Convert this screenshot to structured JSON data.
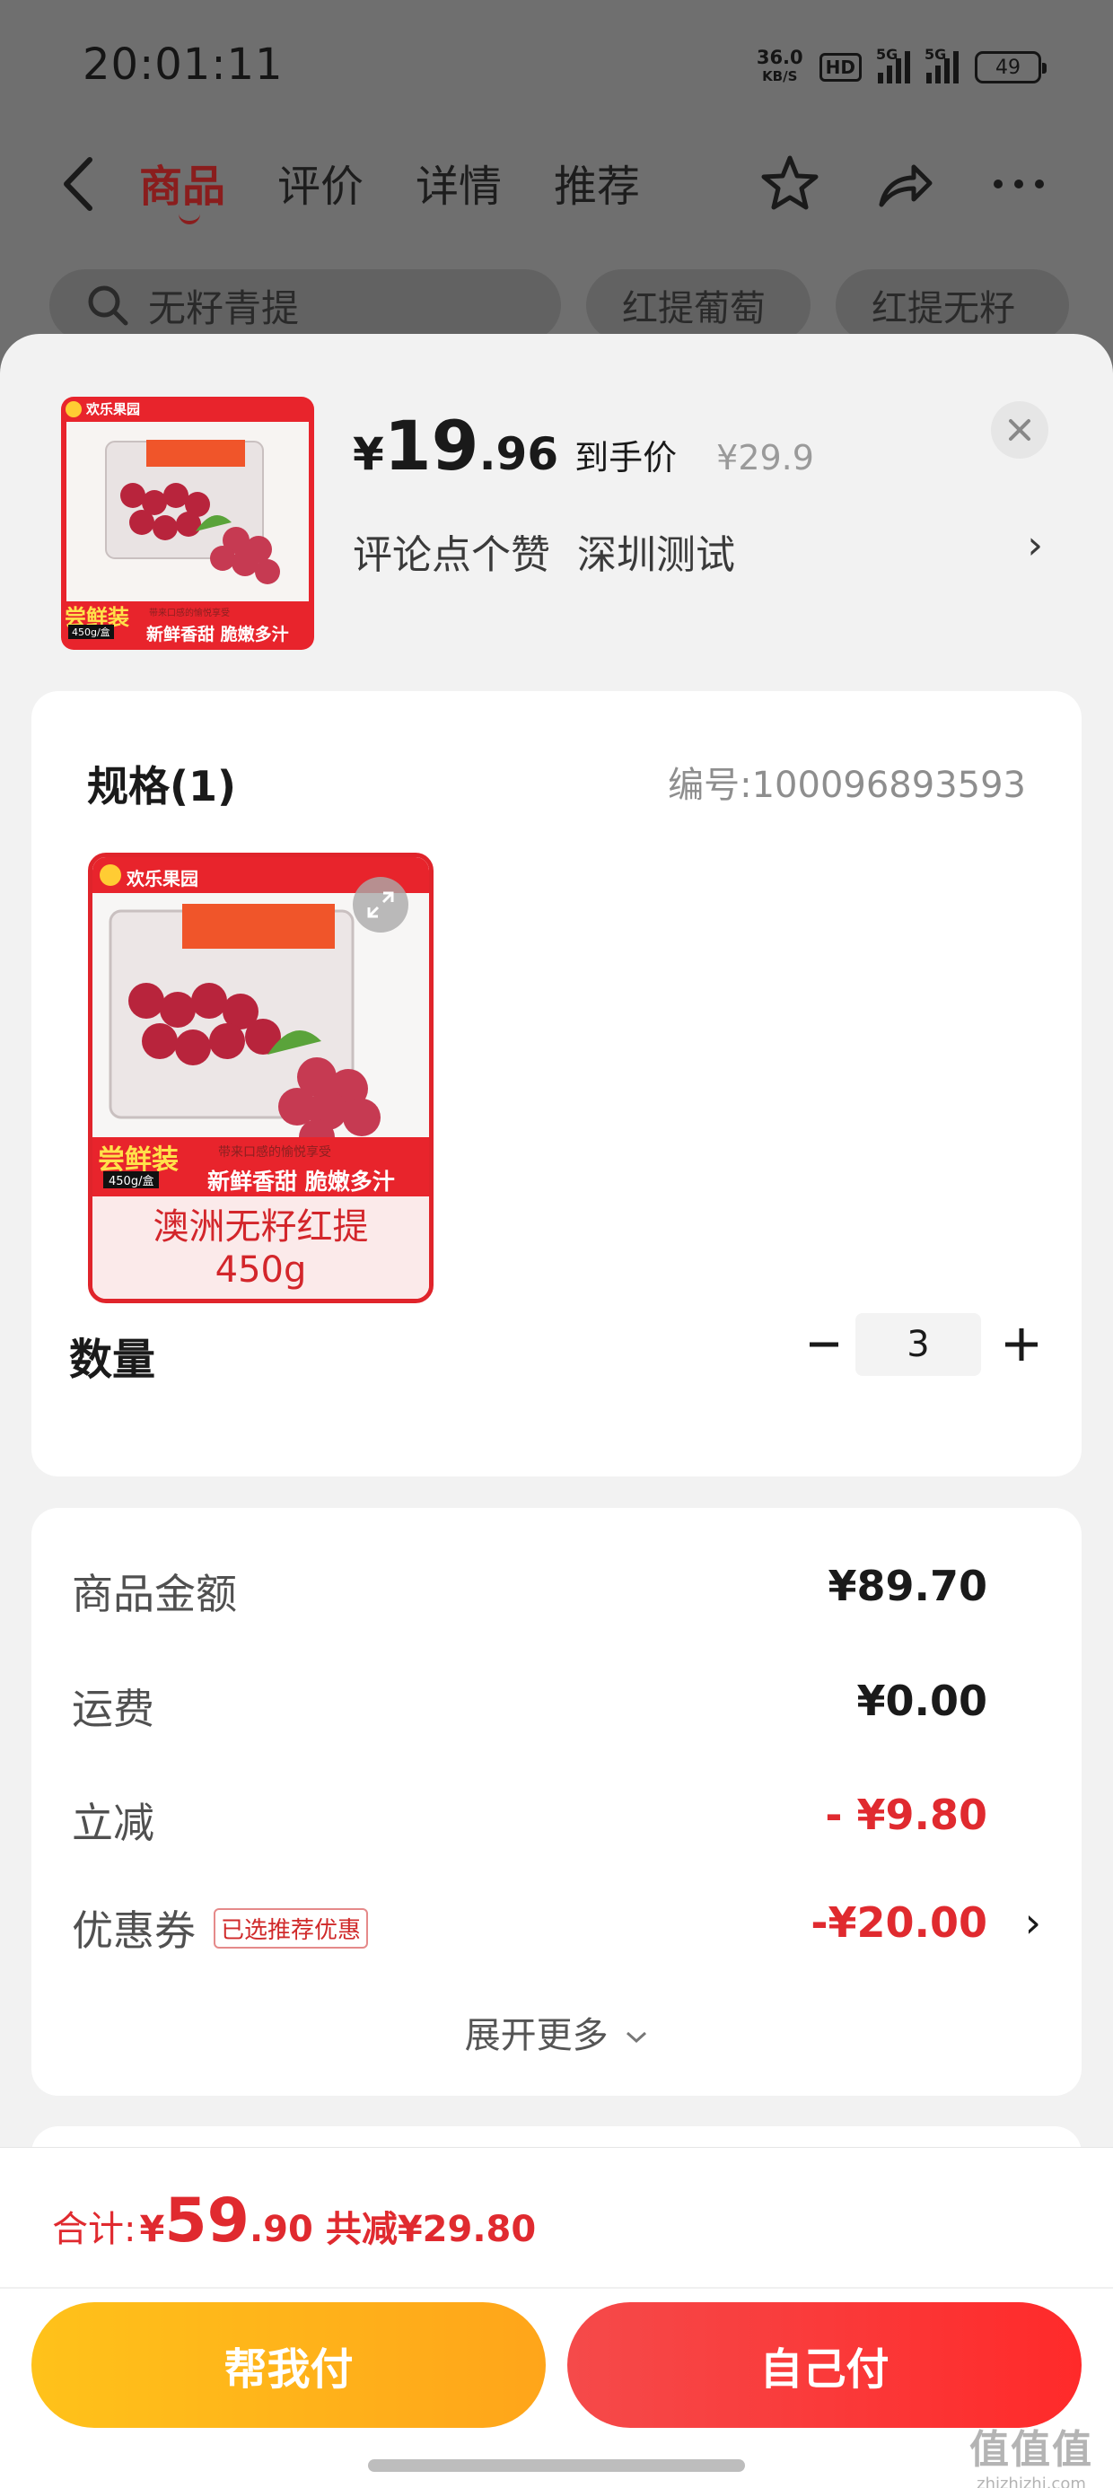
{
  "status_bar": {
    "time": "20:01:11",
    "net_speed_value": "36.0",
    "net_speed_unit": "KB/S",
    "hd_label": "HD",
    "sim1_label": "5G",
    "sim2_label": "5G",
    "battery": "49"
  },
  "nav": {
    "tabs": [
      {
        "label": "商品"
      },
      {
        "label": "评价"
      },
      {
        "label": "详情"
      },
      {
        "label": "推荐"
      }
    ],
    "icons": [
      "back-arrow-icon",
      "star-icon",
      "share-icon",
      "more-icon"
    ]
  },
  "search": {
    "query": "无籽青提",
    "chips": [
      "红提葡萄",
      "红提无籽"
    ]
  },
  "sheet": {
    "price_symbol": "¥",
    "price_int": "19",
    "price_dec": ".96",
    "price_tag": "到手价",
    "orig_price": "¥29.9",
    "sub_text_1": "评论点个赞",
    "sub_text_2": "深圳测试",
    "chevron": "›",
    "thumb_brand": "欢乐果园",
    "thumb_tag": "尝鲜装",
    "thumb_weight": "450g/盒",
    "thumb_slogan": "新鲜香甜 脆嫩多汁",
    "thumb_small_text": "带来口感的愉悦享受"
  },
  "spec": {
    "title": "规格(1)",
    "code": "编号:100096893593",
    "variant_name": "澳洲无籽红提",
    "variant_weight": "450g",
    "quantity_label": "数量",
    "quantity": "3",
    "minus": "−",
    "plus": "+"
  },
  "summary": {
    "rows": [
      {
        "label": "商品金额",
        "value": "¥89.70"
      },
      {
        "label": "运费",
        "value": "¥0.00"
      },
      {
        "label": "立减",
        "value": "- ¥9.80"
      },
      {
        "label": "优惠券",
        "tag": "已选推荐优惠",
        "value": "-¥20.00"
      }
    ],
    "expand_more": "展开更多"
  },
  "footer": {
    "total_label": "合计:",
    "total_symbol": "¥",
    "total_int": "59",
    "total_dec": ".90",
    "total_saved": "共减¥29.80",
    "btn_help": "帮我付",
    "btn_self": "自己付"
  },
  "watermark": {
    "big": "值值值",
    "small": "zhizhizhi.com"
  },
  "colors": {
    "accent_red": "#e02a2f",
    "btn_yellow": "#ffb21a",
    "btn_red": "#f83a3a"
  }
}
